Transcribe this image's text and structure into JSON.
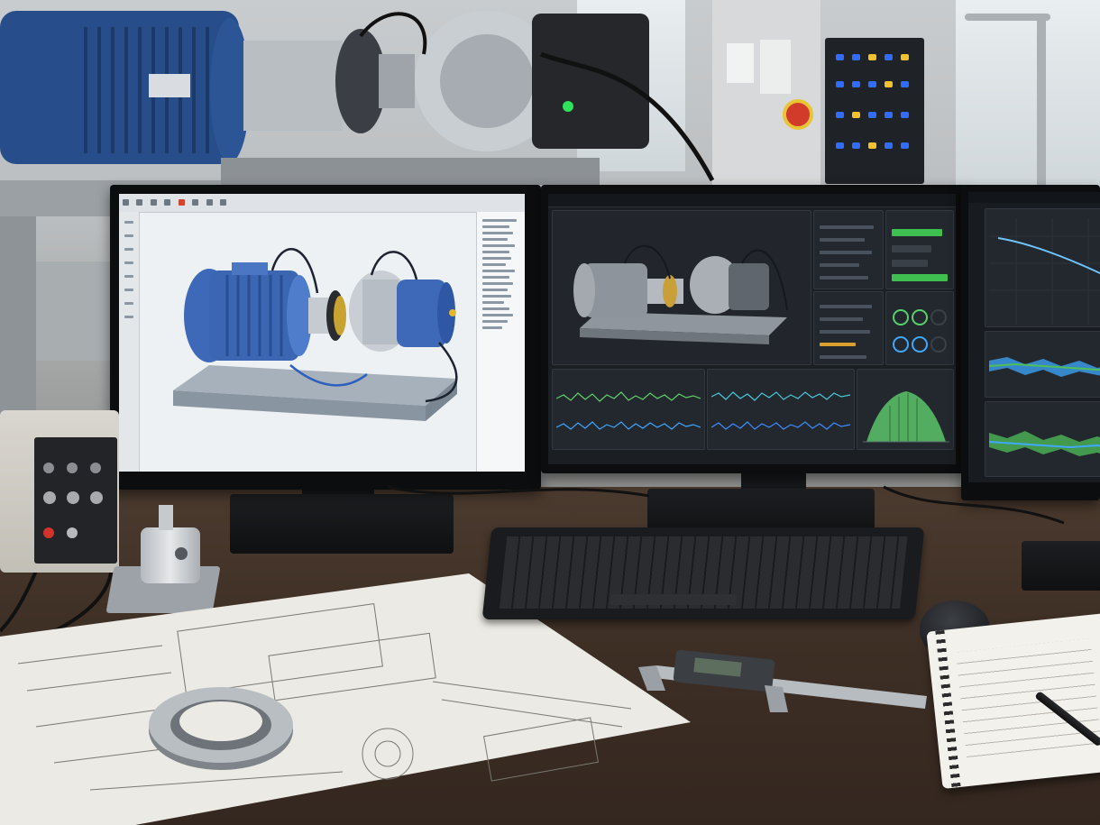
{
  "scene": {
    "description_shown": "",
    "colors": {
      "motor_blue": "#2f5a9e",
      "dash_bg": "#1b1f24",
      "signal_green": "#5fd16a",
      "signal_blue": "#3fa8ff",
      "desk_wood": "#3f3026",
      "status_green": "#3fbf4f"
    }
  },
  "cad_app": {
    "window_title": "",
    "toolbar_icons": [
      "file-icon",
      "save-icon",
      "undo-icon",
      "redo-icon",
      "rotate-icon",
      "zoom-icon",
      "measure-icon",
      "settings-icon"
    ],
    "sidebar_icons": [
      "select-icon",
      "move-icon",
      "rotate-icon",
      "scale-icon",
      "section-icon",
      "layers-icon",
      "camera-icon",
      "view-icon"
    ]
  },
  "dashboard": {
    "charts": [
      {
        "name": "vibration-waveform-top",
        "color": "#5fd16a"
      },
      {
        "name": "vibration-waveform-bottom",
        "color": "#3fa8ff"
      },
      {
        "name": "spectrum-area",
        "color": "#6fd07a"
      }
    ],
    "gauges_count_shown": 6,
    "status_bars": [
      0.9,
      0.7,
      0.6,
      0.8
    ]
  },
  "right_monitor": {
    "trend_color": "#6fc3ff",
    "band_colors": [
      "#3fa8ff",
      "#4fbf5a"
    ]
  },
  "desk_items": [
    "keyboard",
    "mouse",
    "caliper",
    "bearing",
    "notebook",
    "pen",
    "signal-conditioner",
    "accelerometer",
    "technical-drawing"
  ]
}
